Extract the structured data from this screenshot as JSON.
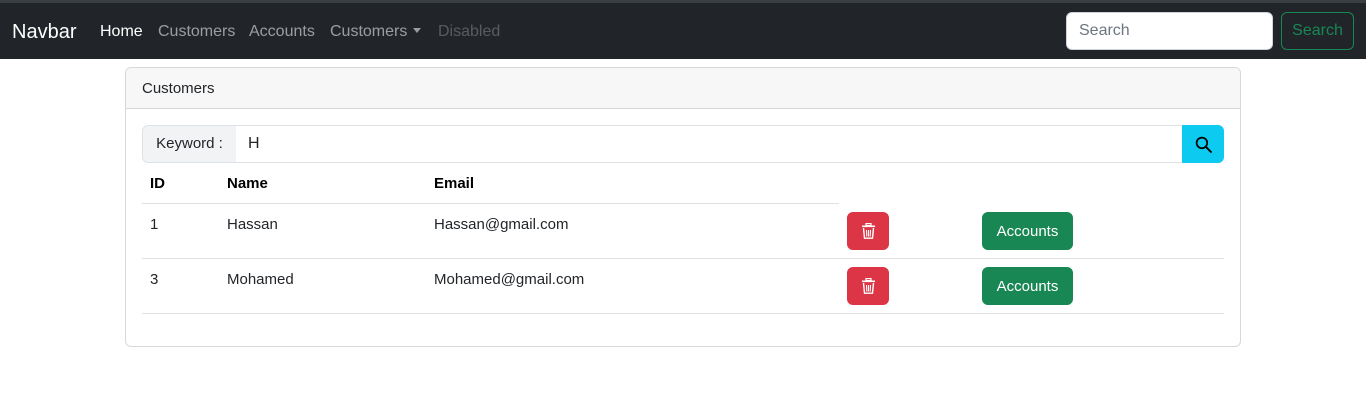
{
  "navbar": {
    "brand": "Navbar",
    "links": [
      {
        "label": "Home",
        "state": "active"
      },
      {
        "label": "Customers",
        "state": "normal"
      },
      {
        "label": "Accounts",
        "state": "normal"
      },
      {
        "label": "Customers",
        "state": "dropdown"
      },
      {
        "label": "Disabled",
        "state": "disabled"
      }
    ],
    "search_placeholder": "Search",
    "search_button": "Search"
  },
  "card": {
    "header": "Customers",
    "keyword_label": "Keyword :",
    "keyword_value": "H",
    "search_icon": "search-icon"
  },
  "table": {
    "columns": [
      "ID",
      "Name",
      "Email"
    ],
    "rows": [
      {
        "id": "1",
        "name": "Hassan",
        "email": "Hassan@gmail.com",
        "delete_icon": "trash-icon",
        "action_label": "Accounts"
      },
      {
        "id": "3",
        "name": "Mohamed",
        "email": "Mohamed@gmail.com",
        "delete_icon": "trash-icon",
        "action_label": "Accounts"
      }
    ]
  },
  "colors": {
    "navbar_bg": "#212529",
    "success": "#198754",
    "danger": "#dc3545",
    "info": "#0dcaf0"
  }
}
